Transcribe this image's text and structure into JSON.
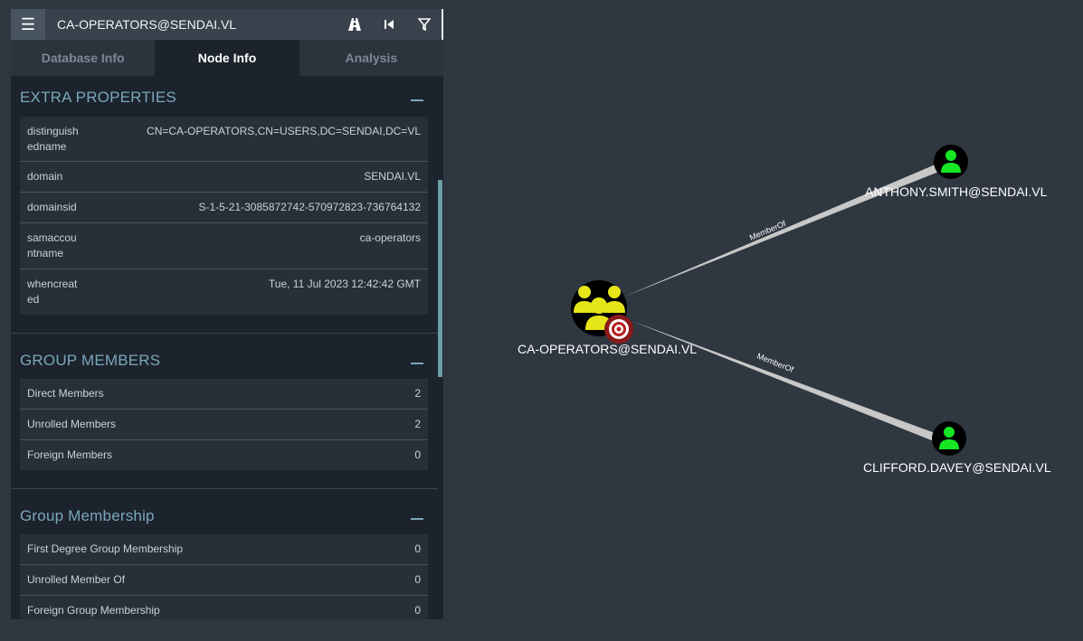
{
  "search": {
    "query": "CA-OPERATORS@SENDAI.VL"
  },
  "toolbar": {
    "menu_icon": "hamburger-icon",
    "pathfinding_icon": "road-icon",
    "back_icon": "step-back-icon",
    "filter_icon": "filter-icon"
  },
  "tabs": [
    {
      "label": "Database Info"
    },
    {
      "label": "Node Info"
    },
    {
      "label": "Analysis"
    }
  ],
  "extra_properties": {
    "title": "EXTRA PROPERTIES",
    "rows": [
      {
        "key": "distinguishedname",
        "value": "CN=CA-OPERATORS,CN=USERS,DC=SENDAI,DC=VL"
      },
      {
        "key": "domain",
        "value": "SENDAI.VL"
      },
      {
        "key": "domainsid",
        "value": "S-1-5-21-3085872742-570972823-736764132"
      },
      {
        "key": "samaccountname",
        "value": "ca-operators"
      },
      {
        "key": "whencreated",
        "value": "Tue, 11 Jul 2023 12:42:42 GMT"
      }
    ]
  },
  "group_members": {
    "title": "GROUP MEMBERS",
    "rows": [
      {
        "key": "Direct Members",
        "value": "2"
      },
      {
        "key": "Unrolled Members",
        "value": "2"
      },
      {
        "key": "Foreign Members",
        "value": "0"
      }
    ]
  },
  "group_membership": {
    "title": "Group Membership",
    "rows": [
      {
        "key": "First Degree Group Membership",
        "value": "0"
      },
      {
        "key": "Unrolled Member Of",
        "value": "0"
      },
      {
        "key": "Foreign Group Membership",
        "value": "0"
      }
    ]
  },
  "graph": {
    "nodes": [
      {
        "label": "CA-OPERATORS@SENDAI.VL",
        "type": "group",
        "color": "#e6e619",
        "target": true
      },
      {
        "label": "ANTHONY.SMITH@SENDAI.VL",
        "type": "user",
        "color": "#17e625"
      },
      {
        "label": "CLIFFORD.DAVEY@SENDAI.VL",
        "type": "user",
        "color": "#17e625"
      }
    ],
    "edges": [
      {
        "label": "MemberOf"
      },
      {
        "label": "MemberOf"
      }
    ]
  }
}
